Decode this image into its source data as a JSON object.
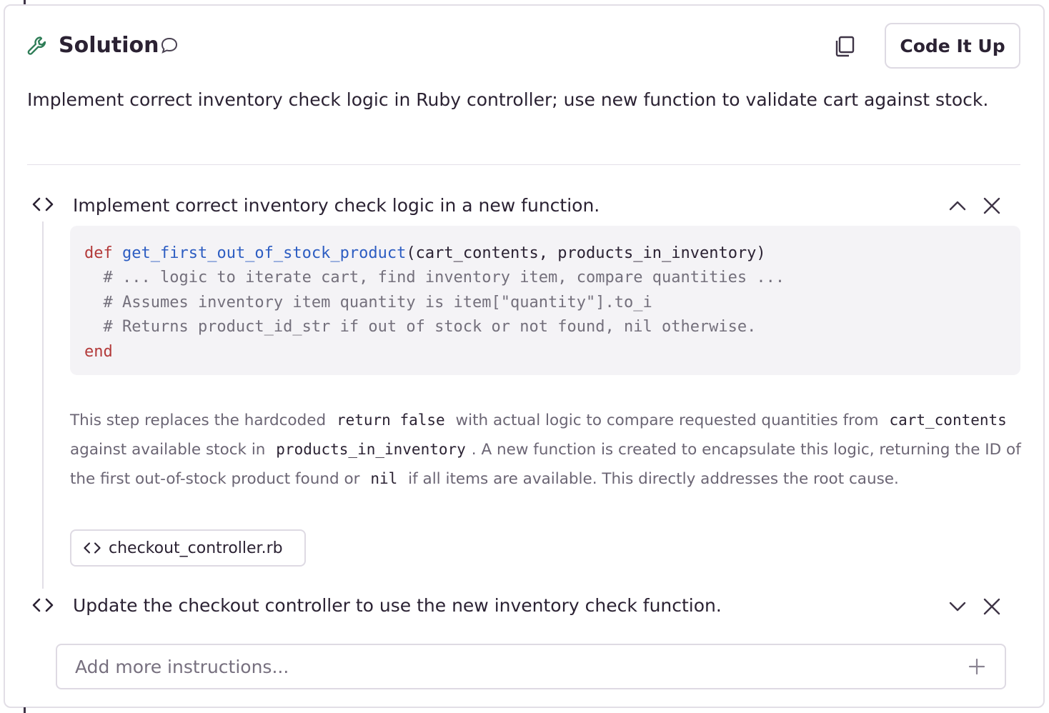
{
  "header": {
    "title": "Solution",
    "wrench_icon": "wrench-icon",
    "chat_icon": "chat-bubble-icon",
    "copy_icon": "copy-icon",
    "code_button_label": "Code It Up",
    "accent_color": "#2f7d57"
  },
  "summary": "Implement correct inventory check logic in Ruby controller; use new function to validate cart against stock.",
  "steps": [
    {
      "title": "Implement correct inventory check logic in a new function.",
      "expanded": true,
      "code": {
        "kw_def": "def",
        "fn_name": "get_first_out_of_stock_product",
        "params": "(cart_contents, products_in_inventory)",
        "comments": [
          "  # ... logic to iterate cart, find inventory item, compare quantities ...",
          "  # Assumes inventory item quantity is item[\"quantity\"].to_i",
          "  # Returns product_id_str if out of stock or not found, nil otherwise."
        ],
        "kw_end": "end"
      },
      "explanation": {
        "t1": "This step replaces the hardcoded",
        "c1": "return false",
        "t2": "with actual logic to compare requested quantities from",
        "c2": "cart_contents",
        "t3": "against available stock in",
        "c3": "products_in_inventory",
        "t4": ". A new function is created to encapsulate this logic, returning the ID of the first out-of-stock product found or",
        "c4": "nil",
        "t5": "if all items are available. This directly addresses the root cause."
      },
      "file": "checkout_controller.rb"
    },
    {
      "title": "Update the checkout controller to use the new inventory check function.",
      "expanded": false
    }
  ],
  "input": {
    "placeholder": "Add more instructions..."
  }
}
